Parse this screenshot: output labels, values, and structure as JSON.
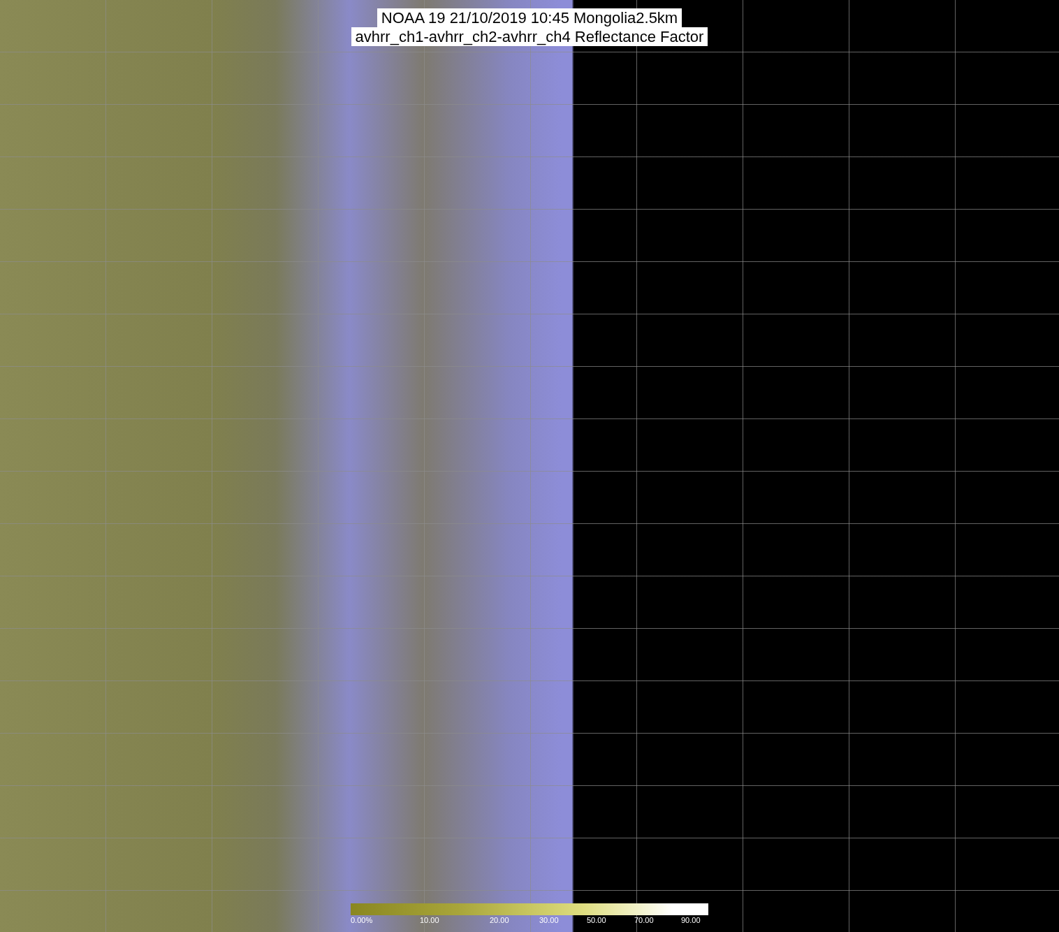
{
  "title": {
    "lines": [
      "NOAA 19 21/10/2019 10:45 Mongolia2.5km",
      "avhrr_ch1-avhrr_ch2-avhrr_ch4 Reflectance Factor"
    ]
  },
  "colorbar": {
    "labels": [
      "0.00%",
      "10.00",
      "20.00",
      "30.00",
      "50.00",
      "70.00",
      "90.00"
    ]
  }
}
